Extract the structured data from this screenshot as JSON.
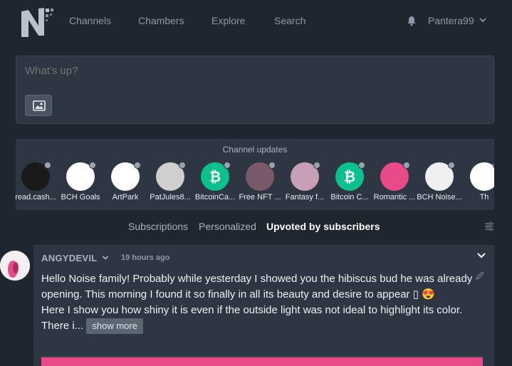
{
  "nav": {
    "logo_text": "N",
    "links": [
      "Channels",
      "Chambers",
      "Explore",
      "Search"
    ],
    "user": "Pantera99",
    "bell_icon": "bell-icon"
  },
  "composer": {
    "placeholder": "What's up?",
    "image_icon": "image-icon"
  },
  "channels": {
    "title": "Channel updates",
    "items": [
      {
        "label": "read.cash...",
        "color": "#1a1a1a"
      },
      {
        "label": "BCH Goals",
        "color": "#ffffff"
      },
      {
        "label": "ArtPark",
        "color": "#ffffff"
      },
      {
        "label": "PatJules8...",
        "color": "#cfcfcf"
      },
      {
        "label": "BitcoinCa...",
        "color": "#0ac18e"
      },
      {
        "label": "Free NFT ...",
        "color": "#7a5a6a"
      },
      {
        "label": "Fantasy f...",
        "color": "#c7a0b8"
      },
      {
        "label": "Bitcoin C...",
        "color": "#0ac18e"
      },
      {
        "label": "Romantic ...",
        "color": "#e84a8a"
      },
      {
        "label": "BCH Noise...",
        "color": "#f0f0f0"
      },
      {
        "label": "Th",
        "color": "#ffffff"
      }
    ]
  },
  "tabs": [
    {
      "label": "Subscriptions",
      "active": false
    },
    {
      "label": "Personalized",
      "active": false
    },
    {
      "label": "Upvoted by subscribers",
      "active": true
    }
  ],
  "post": {
    "author": "ANGYDEVIL",
    "time": "19 hours ago",
    "body": "Hello Noise family! Probably while yesterday I showed you the hibiscus bud he was already opening. This morning I found it so finally in all its beauty and desire to appear ▯ 😍\nHere I show you how shiny it is even if the outside light was not ideal to highlight its color. There i...",
    "show_more": "show more"
  },
  "colors": {
    "background": "#1f2630",
    "panel": "#2d3642",
    "bch_green": "#0ac18e",
    "accent_pink": "#e84a8a"
  }
}
